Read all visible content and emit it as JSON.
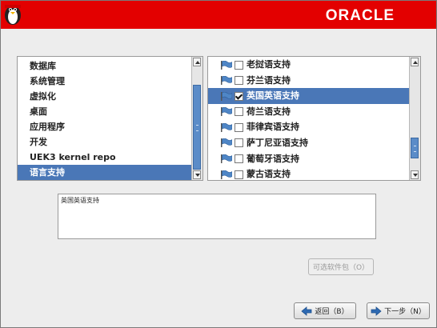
{
  "header": {
    "brand": "ORACLE",
    "mascot_icon": "penguin-mascot-icon",
    "color": "#e30000"
  },
  "groups": {
    "items": [
      {
        "label": "数据库",
        "selected": false
      },
      {
        "label": "系统管理",
        "selected": false
      },
      {
        "label": "虚拟化",
        "selected": false
      },
      {
        "label": "桌面",
        "selected": false
      },
      {
        "label": "应用程序",
        "selected": false
      },
      {
        "label": "开发",
        "selected": false
      },
      {
        "label": "UEK3 kernel repo",
        "selected": false
      },
      {
        "label": "语言支持",
        "selected": true
      }
    ],
    "scroll_position": 1.0
  },
  "languages": {
    "items": [
      {
        "label": "老挝语支持",
        "checked": false,
        "selected": false
      },
      {
        "label": "芬兰语支持",
        "checked": false,
        "selected": false
      },
      {
        "label": "英国英语支持",
        "checked": true,
        "selected": true
      },
      {
        "label": "荷兰语支持",
        "checked": false,
        "selected": false
      },
      {
        "label": "菲律宾语支持",
        "checked": false,
        "selected": false
      },
      {
        "label": "萨丁尼亚语支持",
        "checked": false,
        "selected": false
      },
      {
        "label": "葡萄牙语支持",
        "checked": false,
        "selected": false
      },
      {
        "label": "蒙古语支持",
        "checked": false,
        "selected": false
      }
    ],
    "scroll_position": 0.86
  },
  "description": {
    "text": "英国英语支持"
  },
  "buttons": {
    "optional_packages": "可选软件包（O）",
    "back": "返回（B）",
    "next": "下一步（N）"
  },
  "colors": {
    "selection": "#4a77b7",
    "brand": "#e30000",
    "flag": "#4f86c6"
  }
}
